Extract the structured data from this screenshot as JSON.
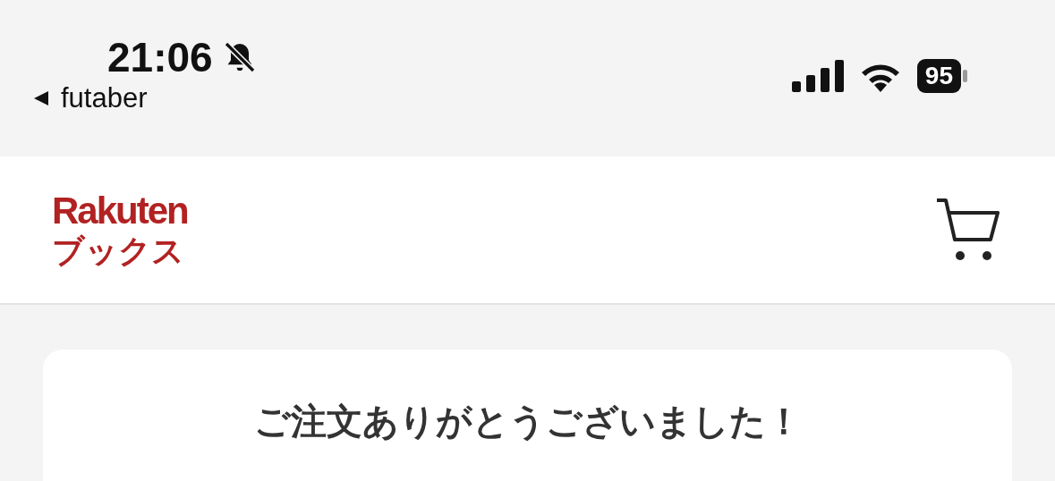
{
  "status_bar": {
    "time": "21:06",
    "back_label": "futaber",
    "battery": "95"
  },
  "header": {
    "logo_top": "Rakuten",
    "logo_bottom": "ブックス"
  },
  "card": {
    "title": "ご注文ありがとうございました！"
  }
}
